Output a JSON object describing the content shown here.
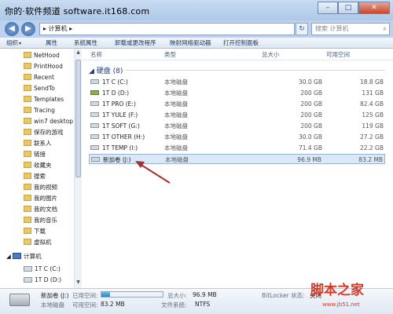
{
  "watermark": "你的·软件频道 software.it168.com",
  "window_buttons": {
    "minimize": "–",
    "maximize": "□",
    "close": "✕"
  },
  "address": {
    "path": "▸ 计算机 ▸",
    "search_placeholder": "搜索 计算机"
  },
  "toolbar": [
    "组织",
    "属性",
    "系统属性",
    "卸载或更改程序",
    "映射网络驱动器",
    "打开控制面板"
  ],
  "nav": {
    "items": [
      "NetHood",
      "PrintHood",
      "Recent",
      "SendTo",
      "Templates",
      "Tracing",
      "win7 desktop",
      "保存的游戏",
      "联系人",
      "链接",
      "收藏夹",
      "搜索",
      "我的视频",
      "我的图片",
      "我的文档",
      "我的音乐",
      "下载",
      "虚拟机"
    ],
    "computer": "计算机",
    "drives": [
      "1T C (C:)",
      "1T D (D:)"
    ]
  },
  "columns": {
    "name": "名称",
    "type": "类型",
    "total": "总大小",
    "free": "可用空间"
  },
  "group": "硬盘 (8)",
  "drives": [
    {
      "name": "1T C (C:)",
      "type": "本地磁盘",
      "total": "30.0 GB",
      "free": "18.8 GB"
    },
    {
      "name": "1T D (D:)",
      "type": "本地磁盘",
      "total": "200 GB",
      "free": "131 GB"
    },
    {
      "name": "1T PRO (E:)",
      "type": "本地磁盘",
      "total": "200 GB",
      "free": "82.4 GB"
    },
    {
      "name": "1T YULE (F:)",
      "type": "本地磁盘",
      "total": "200 GB",
      "free": "125 GB"
    },
    {
      "name": "1T SOFT (G:)",
      "type": "本地磁盘",
      "total": "200 GB",
      "free": "119 GB"
    },
    {
      "name": "1T OTHER (H:)",
      "type": "本地磁盘",
      "total": "30.0 GB",
      "free": "27.2 GB"
    },
    {
      "name": "1T TEMP (I:)",
      "type": "本地磁盘",
      "total": "71.4 GB",
      "free": "22.2 GB"
    },
    {
      "name": "新加卷 (J:)",
      "type": "本地磁盘",
      "total": "96.9 MB",
      "free": "83.2 MB"
    }
  ],
  "details": {
    "drive_name": "新加卷 (J:)",
    "drive_type": "本地磁盘",
    "used_label": "已用空间:",
    "free_label": "可用空间:",
    "free_value": "83.2 MB",
    "total_label": "总大小:",
    "total_value": "96.9 MB",
    "fs_label": "文件系统:",
    "fs_value": "NTFS",
    "bitlocker_label": "BitLocker 状态:",
    "bitlocker_value": "关闭",
    "used_fraction": 0.14
  },
  "logo": {
    "main": "脚本之家",
    "sub": "www.jb51.net"
  }
}
